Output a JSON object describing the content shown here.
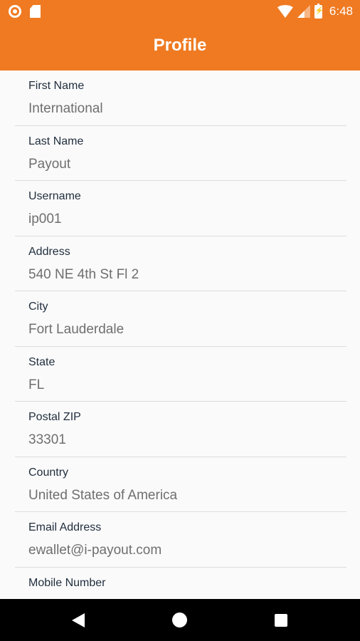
{
  "status_bar": {
    "time": "6:48",
    "icons": [
      "notification-icon",
      "sdcard-icon",
      "wifi-icon",
      "signal-icon",
      "battery-charging-icon"
    ]
  },
  "header": {
    "title": "Profile",
    "background_color": "#ef7a22"
  },
  "profile": {
    "fields": [
      {
        "label": "First Name",
        "value": "International"
      },
      {
        "label": "Last Name",
        "value": "Payout"
      },
      {
        "label": "Username",
        "value": "ip001"
      },
      {
        "label": "Address",
        "value": "540 NE 4th St Fl 2"
      },
      {
        "label": "City",
        "value": "Fort Lauderdale"
      },
      {
        "label": "State",
        "value": "FL"
      },
      {
        "label": "Postal ZIP",
        "value": "33301"
      },
      {
        "label": "Country",
        "value": "United States of America"
      },
      {
        "label": "Email Address",
        "value": "ewallet@i-payout.com"
      },
      {
        "label": "Mobile Number",
        "value": ""
      }
    ]
  },
  "nav_bar": {
    "icons": [
      "back-icon",
      "home-icon",
      "recents-icon"
    ]
  }
}
